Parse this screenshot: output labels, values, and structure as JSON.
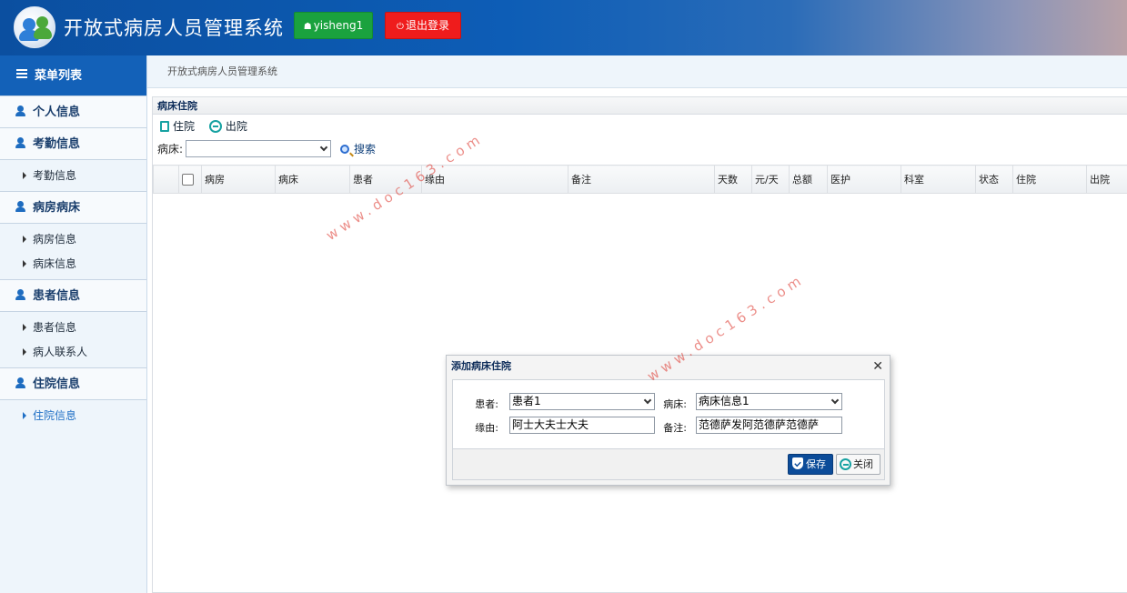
{
  "header": {
    "title": "开放式病房人员管理系统",
    "user_button": "yisheng1",
    "logout_button": "退出登录"
  },
  "sidebar": {
    "title": "菜单列表",
    "groups": [
      {
        "label": "个人信息",
        "items": []
      },
      {
        "label": "考勤信息",
        "items": [
          "考勤信息"
        ]
      },
      {
        "label": "病房病床",
        "items": [
          "病房信息",
          "病床信息"
        ]
      },
      {
        "label": "患者信息",
        "items": [
          "患者信息",
          "病人联系人"
        ]
      },
      {
        "label": "住院信息",
        "items": [
          "住院信息"
        ]
      }
    ],
    "active_item": "住院信息"
  },
  "breadcrumb": "开放式病房人员管理系统",
  "panel": {
    "title": "病床住院",
    "toolbar": {
      "admit": "住院",
      "discharge": "出院"
    },
    "search": {
      "label": "病床:",
      "value": "",
      "button": "搜索"
    },
    "columns": [
      "病房",
      "病床",
      "患者",
      "缘由",
      "备注",
      "天数",
      "元/天",
      "总额",
      "医护",
      "科室",
      "状态",
      "住院",
      "出院"
    ],
    "rows": []
  },
  "dialog": {
    "title": "添加病床住院",
    "patient_label": "患者:",
    "patient_value": "患者1",
    "bed_label": "病床:",
    "bed_value": "病床信息1",
    "reason_label": "缘由:",
    "reason_value": "阿士大夫士大夫",
    "remark_label": "备注:",
    "remark_value": "范德萨发阿范德萨范德萨",
    "save_button": "保存",
    "close_button": "关闭"
  },
  "watermark": "www.doc163.com",
  "colors": {
    "header": "#0d5db6",
    "user_button": "#1aa23e",
    "logout_button": "#ef1c1c",
    "save_button": "#0c4c99",
    "accent": "#1f6fc5"
  }
}
